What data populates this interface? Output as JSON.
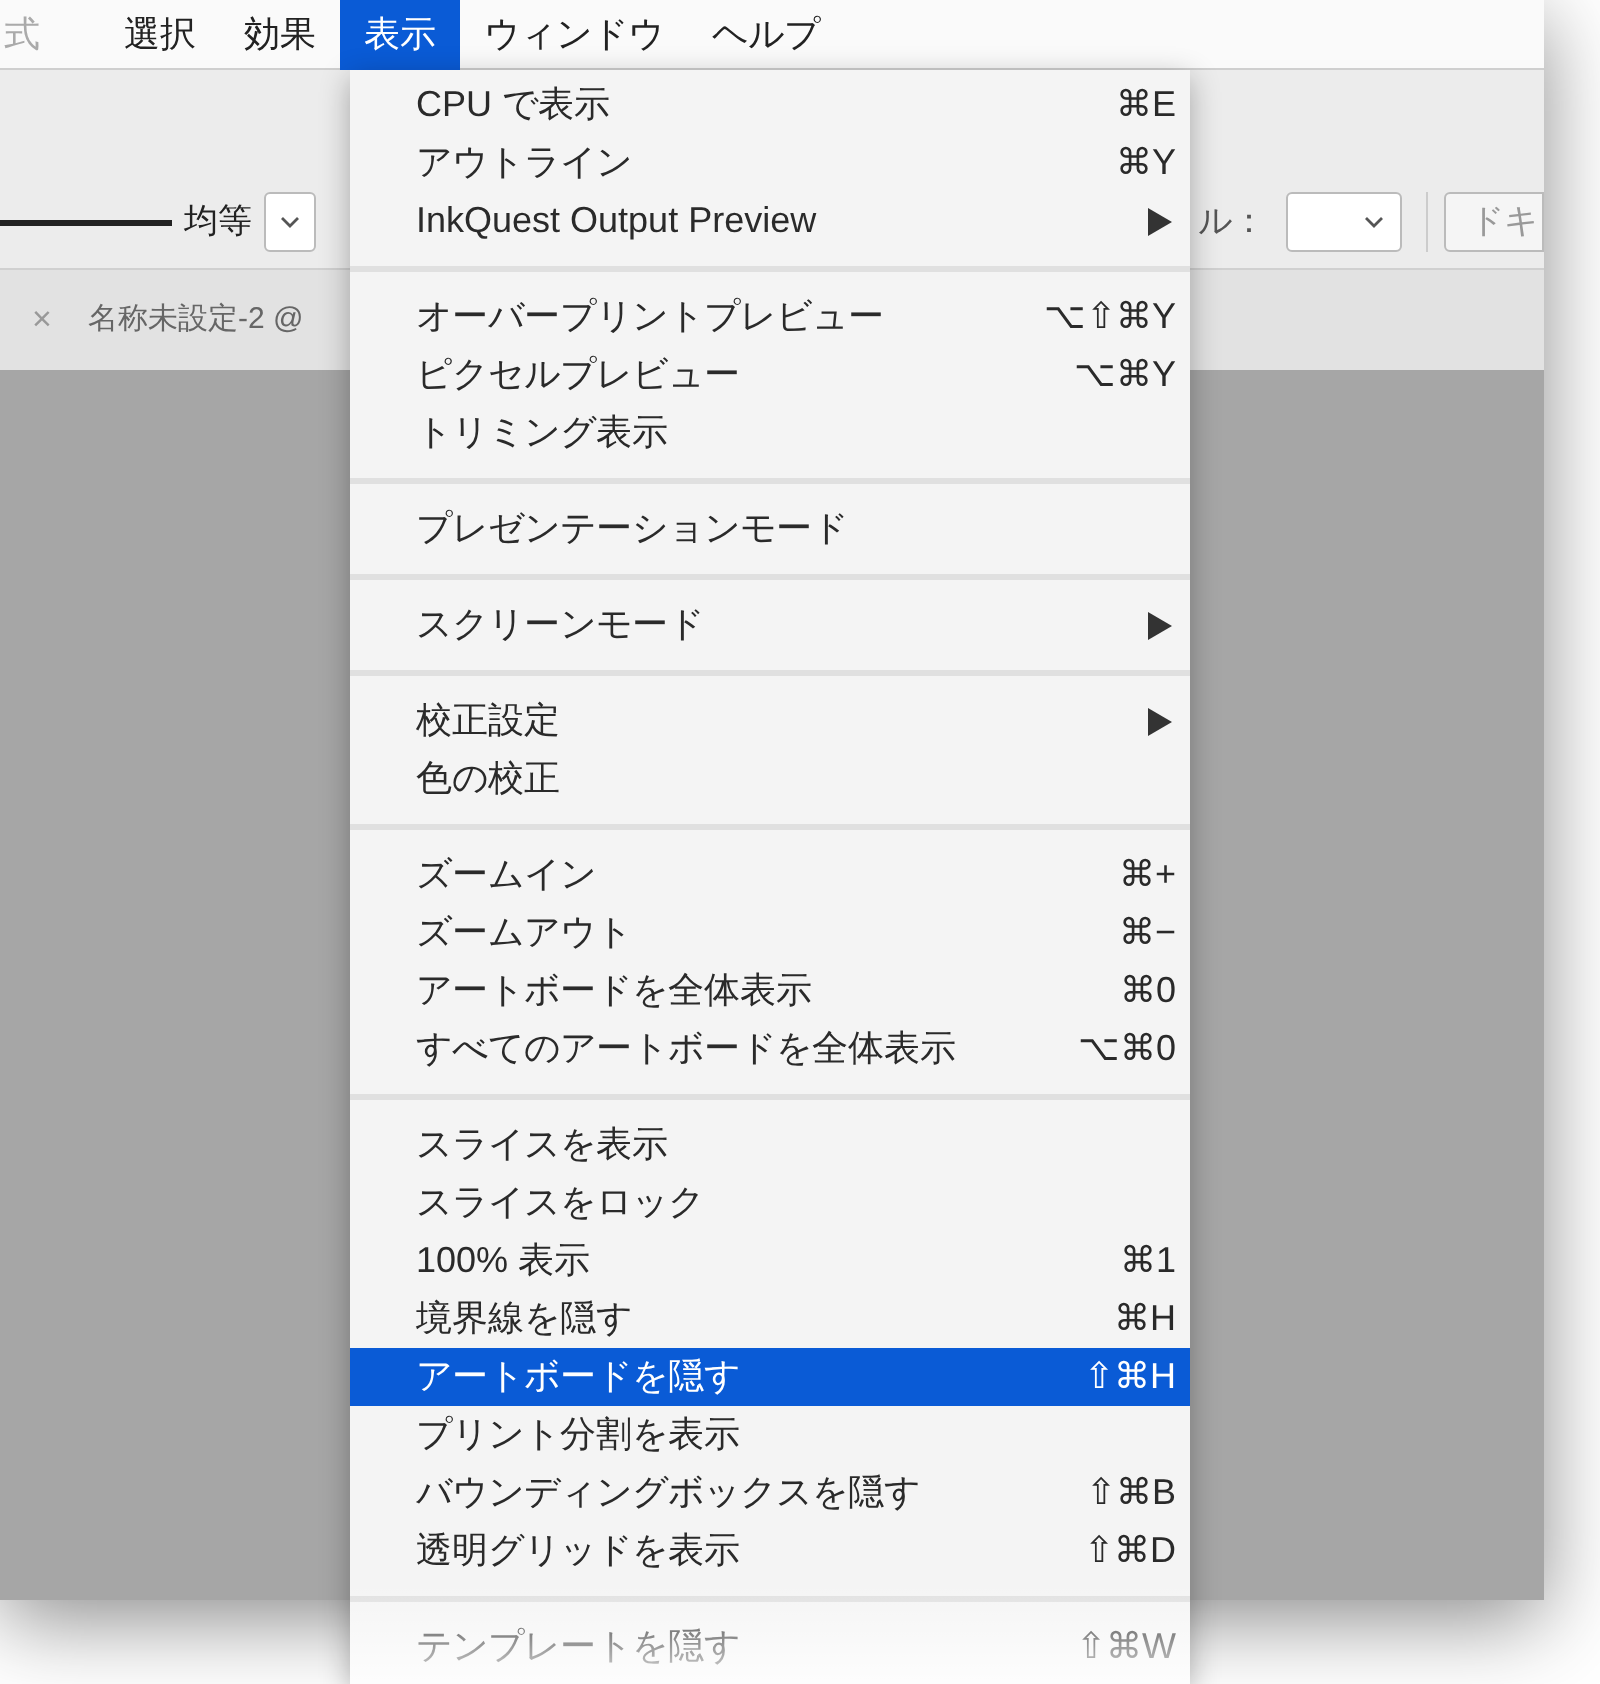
{
  "menubar": [
    {
      "label": "式",
      "selected": false
    },
    {
      "label": "選択",
      "selected": false
    },
    {
      "label": "効果",
      "selected": false
    },
    {
      "label": "表示",
      "selected": true
    },
    {
      "label": "ウィンドウ",
      "selected": false
    },
    {
      "label": "ヘルプ",
      "selected": false
    }
  ],
  "toolbar": {
    "stroke_profile": "均等",
    "fill_label": "ル：",
    "button": "ドキ"
  },
  "document_tab": {
    "close": "×",
    "title": "名称未設定-2 @"
  },
  "menu": {
    "groups": [
      {
        "items": [
          {
            "label": "CPU で表示",
            "shortcut": "⌘E",
            "submenu": false,
            "selected": false
          },
          {
            "label": "アウトライン",
            "shortcut": "⌘Y",
            "submenu": false,
            "selected": false
          },
          {
            "label": "InkQuest Output Preview",
            "submenu": true,
            "selected": false
          }
        ]
      },
      {
        "items": [
          {
            "label": "オーバープリントプレビュー",
            "shortcut": "⌥⇧⌘Y",
            "submenu": false,
            "selected": false
          },
          {
            "label": "ピクセルプレビュー",
            "shortcut": "⌥⌘Y",
            "submenu": false,
            "selected": false
          },
          {
            "label": "トリミング表示",
            "submenu": false,
            "selected": false
          }
        ]
      },
      {
        "items": [
          {
            "label": "プレゼンテーションモード",
            "submenu": false,
            "selected": false
          }
        ]
      },
      {
        "items": [
          {
            "label": "スクリーンモード",
            "submenu": true,
            "selected": false
          }
        ]
      },
      {
        "items": [
          {
            "label": "校正設定",
            "submenu": true,
            "selected": false
          },
          {
            "label": "色の校正",
            "submenu": false,
            "selected": false
          }
        ]
      },
      {
        "items": [
          {
            "label": "ズームイン",
            "shortcut": "⌘+",
            "submenu": false,
            "selected": false
          },
          {
            "label": "ズームアウト",
            "shortcut": "⌘−",
            "submenu": false,
            "selected": false
          },
          {
            "label": "アートボードを全体表示",
            "shortcut": "⌘0",
            "submenu": false,
            "selected": false
          },
          {
            "label": "すべてのアートボードを全体表示",
            "shortcut": "⌥⌘0",
            "submenu": false,
            "selected": false
          }
        ]
      },
      {
        "items": [
          {
            "label": "スライスを表示",
            "submenu": false,
            "selected": false
          },
          {
            "label": "スライスをロック",
            "submenu": false,
            "selected": false
          },
          {
            "label": "100% 表示",
            "shortcut": "⌘1",
            "submenu": false,
            "selected": false
          },
          {
            "label": "境界線を隠す",
            "shortcut": "⌘H",
            "submenu": false,
            "selected": false
          },
          {
            "label": "アートボードを隠す",
            "shortcut": "⇧⌘H",
            "submenu": false,
            "selected": true
          },
          {
            "label": "プリント分割を表示",
            "submenu": false,
            "selected": false
          },
          {
            "label": "バウンディングボックスを隠す",
            "shortcut": "⇧⌘B",
            "submenu": false,
            "selected": false
          },
          {
            "label": "透明グリッドを表示",
            "shortcut": "⇧⌘D",
            "submenu": false,
            "selected": false
          }
        ]
      },
      {
        "items": [
          {
            "label": "テンプレートを隠す",
            "shortcut": "⇧⌘W",
            "submenu": false,
            "selected": false
          }
        ]
      }
    ]
  }
}
